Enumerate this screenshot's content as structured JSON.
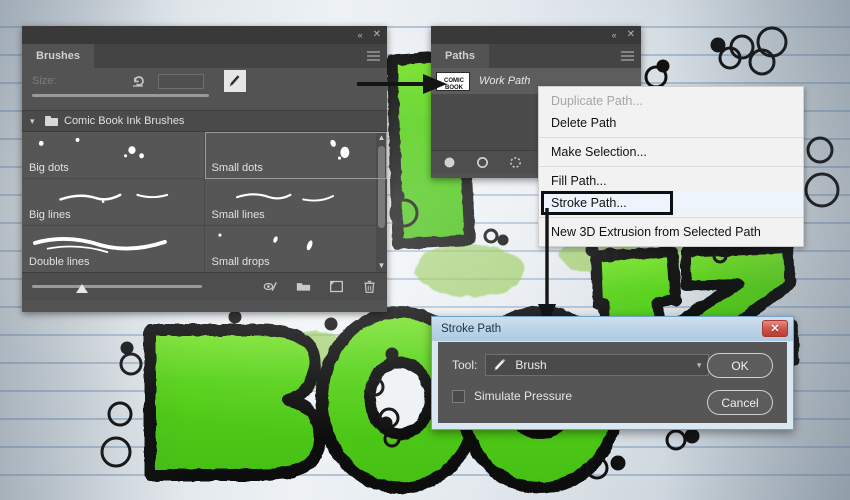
{
  "artwork": {
    "description": "comic-book lettering artwork on lined paper",
    "letters": "BOOIZ",
    "green": "#5ad61e",
    "green_dark": "#3ea512",
    "green_light": "#9ee83a",
    "ink": "#0d0d0d",
    "paper": "#e8edf1",
    "rule_line": "#5f82aa"
  },
  "brushes_panel": {
    "tab_label": "Brushes",
    "collapse_icon": "collapse-icon",
    "close_icon": "close-icon",
    "menu_icon": "panel-menu-icon",
    "size_label": "Size:",
    "size_value": "",
    "reset_icon": "reset-icon",
    "brush_preview_icon": "brush-preview-icon",
    "group": {
      "label": "Comic Book Ink Brushes",
      "expand_icon": "chevron-down-icon",
      "folder_icon": "folder-icon"
    },
    "brushes": [
      {
        "name": "Big dots",
        "selected": false,
        "stroke": "dots-big"
      },
      {
        "name": "Small dots",
        "selected": true,
        "stroke": "dots-small"
      },
      {
        "name": "Big lines",
        "selected": false,
        "stroke": "lines-big"
      },
      {
        "name": "Small lines",
        "selected": false,
        "stroke": "lines-small"
      },
      {
        "name": "Double lines",
        "selected": false,
        "stroke": "lines-double"
      },
      {
        "name": "Small drops",
        "selected": false,
        "stroke": "drops-small"
      }
    ],
    "footer_icons": [
      "brush-settings-icon",
      "folder-icon",
      "new-brush-icon",
      "delete-brush-icon"
    ],
    "scroll_up_icon": "scroll-up-icon",
    "scroll_down_icon": "scroll-down-icon"
  },
  "paths_panel": {
    "tab_label": "Paths",
    "collapse_icon": "collapse-icon",
    "close_icon": "close-icon",
    "menu_icon": "panel-menu-icon",
    "path_name": "Work Path",
    "thumbnail_text": "COMIC BOOK",
    "footer_icons": [
      "fill-path-icon",
      "stroke-path-icon",
      "path-to-selection-icon"
    ]
  },
  "context_menu": {
    "items": [
      {
        "label": "Duplicate Path...",
        "disabled": true,
        "highlight": false
      },
      {
        "label": "Delete Path",
        "disabled": false,
        "highlight": false
      },
      {
        "sep": true
      },
      {
        "label": "Make Selection...",
        "disabled": false,
        "highlight": false
      },
      {
        "sep": true
      },
      {
        "label": "Fill Path...",
        "disabled": false,
        "highlight": false
      },
      {
        "label": "Stroke Path...",
        "disabled": false,
        "highlight": true
      },
      {
        "sep": true
      },
      {
        "label": "New 3D Extrusion from Selected Path",
        "disabled": false,
        "highlight": false
      }
    ]
  },
  "stroke_dialog": {
    "title": "Stroke Path",
    "close_icon": "close-icon",
    "tool_label": "Tool:",
    "tool_value": "Brush",
    "tool_icon": "brush-icon",
    "caret_icon": "chevron-down-icon",
    "checkbox_label": "Simulate Pressure",
    "checkbox_checked": false,
    "ok_label": "OK",
    "cancel_label": "Cancel"
  },
  "annotations": {
    "arrow_to_thumbnail": "arrow-right-icon",
    "arrow_to_dialog": "arrow-down-icon"
  }
}
